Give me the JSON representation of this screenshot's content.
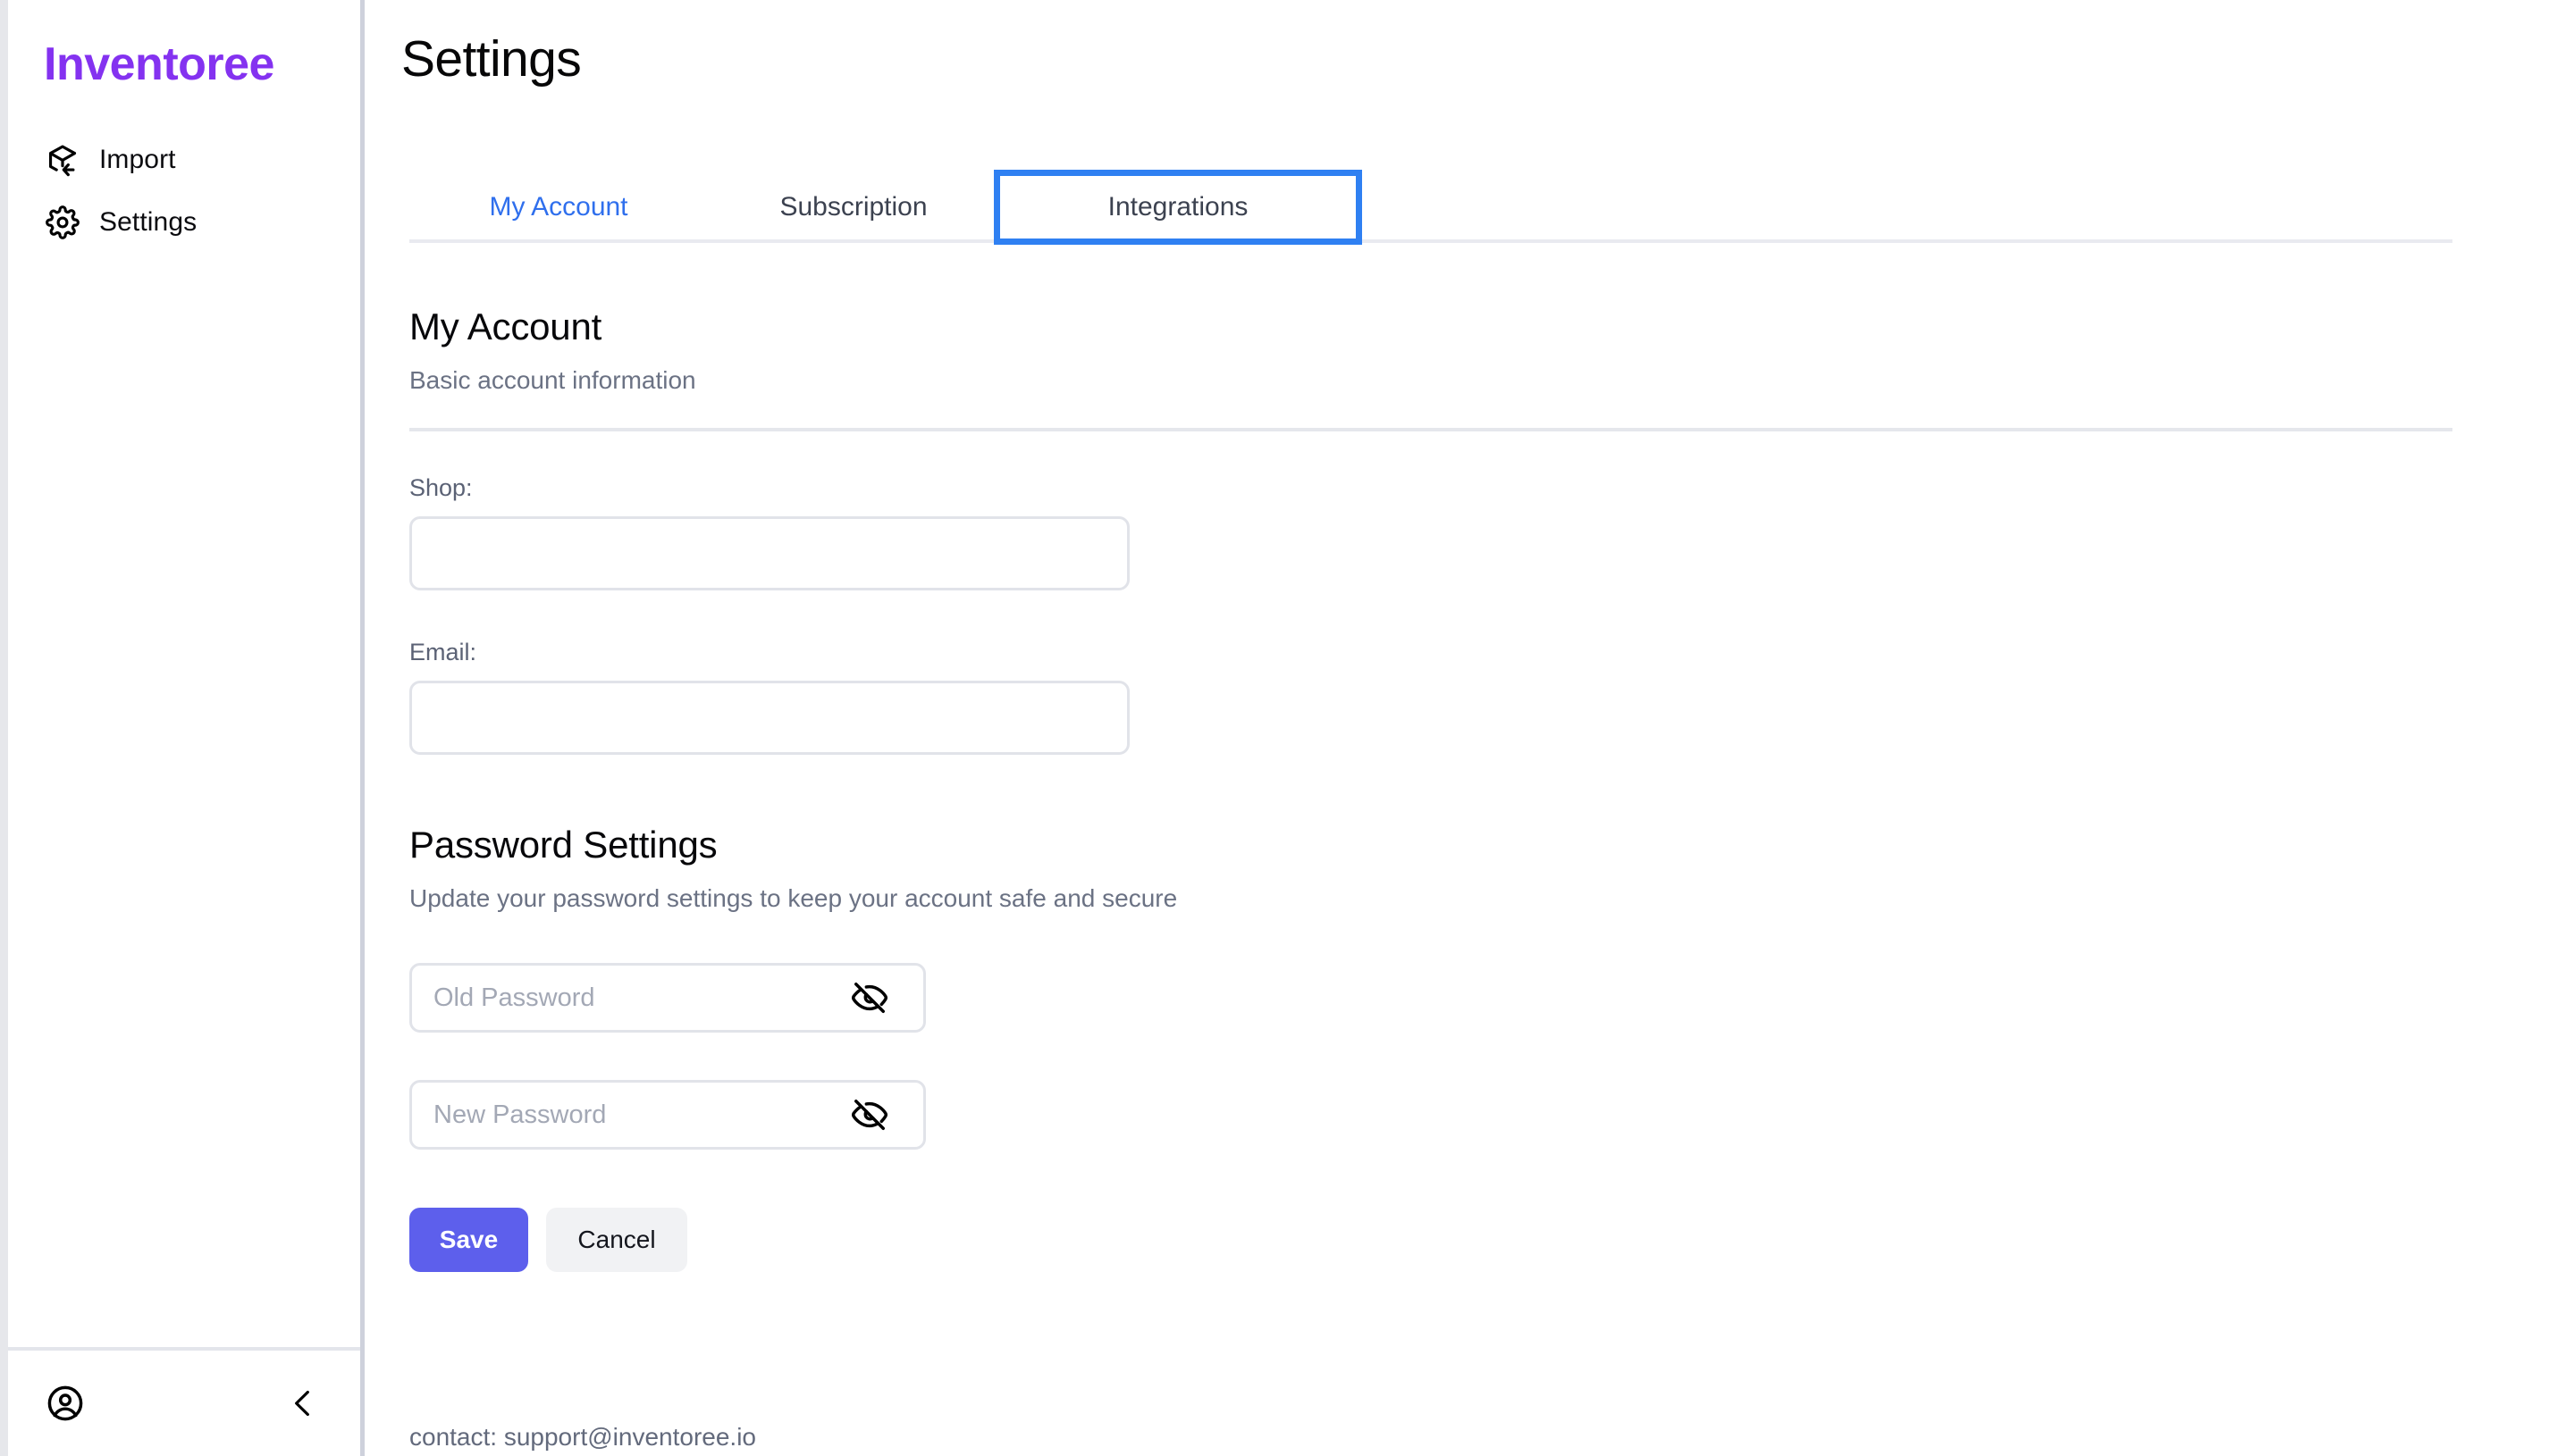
{
  "app": {
    "brand": "Inventoree",
    "accent_purple": "#8432f0",
    "accent_blue": "#2f6fed",
    "focus_blue": "#2f80f2",
    "save_indigo": "#5d5fec"
  },
  "sidebar": {
    "items": [
      {
        "label": "Import",
        "icon": "package-import-icon"
      },
      {
        "label": "Settings",
        "icon": "gear-icon"
      }
    ],
    "footer": {
      "avatar_icon": "user-circle-icon",
      "collapse_icon": "chevron-left-icon"
    }
  },
  "header": {
    "title": "Settings"
  },
  "tabs": [
    {
      "label": "My Account",
      "state": "active"
    },
    {
      "label": "Subscription",
      "state": "inactive"
    },
    {
      "label": "Integrations",
      "state": "focused"
    }
  ],
  "account_section": {
    "title": "My Account",
    "subtitle": "Basic account information",
    "fields": [
      {
        "label": "Shop:",
        "value": "",
        "placeholder": ""
      },
      {
        "label": "Email:",
        "value": "",
        "placeholder": ""
      }
    ]
  },
  "password_section": {
    "title": "Password Settings",
    "subtitle": "Update your password settings to keep your account safe and secure",
    "old_password": {
      "value": "",
      "placeholder": "Old Password",
      "toggle_icon": "eye-off-icon"
    },
    "new_password": {
      "value": "",
      "placeholder": "New Password",
      "toggle_icon": "eye-off-icon"
    }
  },
  "actions": {
    "save_label": "Save",
    "cancel_label": "Cancel"
  },
  "footer": {
    "contact": "contact: support@inventoree.io"
  }
}
